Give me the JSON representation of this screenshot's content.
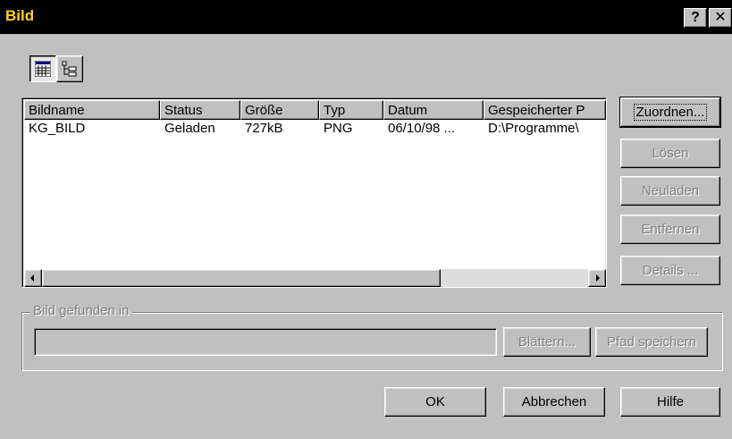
{
  "window": {
    "title": "Bild",
    "help_button": "?",
    "close_button": "✕"
  },
  "toolbar": {
    "list_view_icon": "list-view-icon",
    "tree_view_icon": "tree-view-icon"
  },
  "list": {
    "columns": [
      "Bildname",
      "Status",
      "Größe",
      "Typ",
      "Datum",
      "Gespeicherter P"
    ],
    "rows": [
      [
        "KG_BILD",
        "Geladen",
        "727kB",
        "PNG",
        "06/10/98 ...",
        "D:\\Programme\\"
      ]
    ]
  },
  "side_buttons": {
    "attach": "Zuordnen...",
    "detach": "Lösen",
    "reload": "Neuladen",
    "remove": "Entfernen",
    "details": "Details ..."
  },
  "found_in": {
    "legend": "Bild gefunden in",
    "value": "",
    "browse": "Blättern...",
    "save_path": "Pfad speichern"
  },
  "footer": {
    "ok": "OK",
    "cancel": "Abbrechen",
    "help": "Hilfe"
  }
}
